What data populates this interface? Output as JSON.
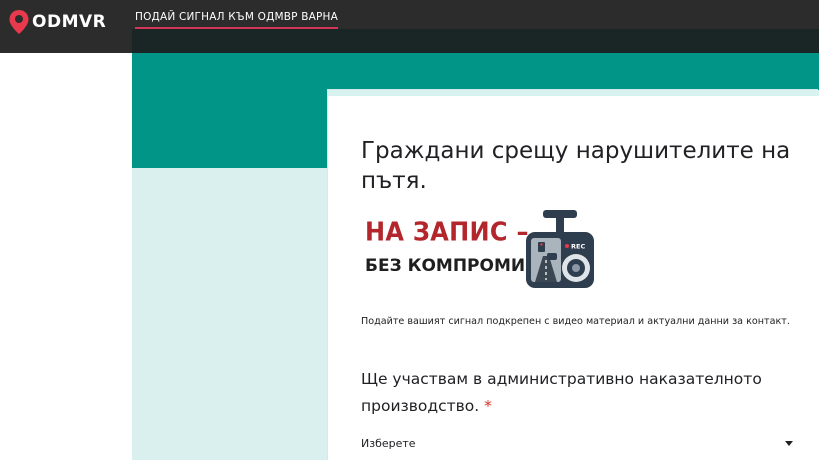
{
  "header": {
    "logo_text": "ODMVR",
    "nav_link": "ПОДАЙ СИГНАЛ КЪМ ОДМВР ВАРНА"
  },
  "form": {
    "title": "Граждани срещу нарушителите на пътя.",
    "banner": {
      "line1": "НА ЗАПИС –",
      "line2": "БЕЗ КОМПРОМИС",
      "rec_label": "REC"
    },
    "description": "Подайте вашият сигнал подкрепен с видео материал и актуални данни за контакт.",
    "question": {
      "text": "Ще участвам в административно наказателното производство.",
      "required_mark": "*"
    },
    "select": {
      "selected_value": "Изберете"
    }
  },
  "colors": {
    "topbar": "#2c2c2c",
    "accent_teal": "#009587",
    "pale_teal": "#d9f0ef",
    "nav_underline": "#d2355a",
    "logo_red": "#e8394d",
    "banner_red": "#b3262c"
  },
  "icons": {
    "logo": "map-pin-icon",
    "banner_camera": "dashcam-icon",
    "select_arrow": "caret-down-icon"
  }
}
